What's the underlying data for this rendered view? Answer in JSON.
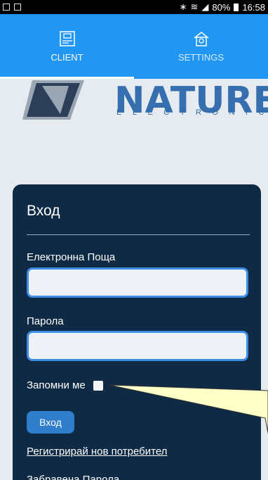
{
  "status_bar": {
    "battery": "80%",
    "time": "16:58"
  },
  "tabs": [
    {
      "label": "CLIENT",
      "icon": "device-icon",
      "active": true
    },
    {
      "label": "SETTINGS",
      "icon": "home-settings-icon",
      "active": false
    }
  ],
  "logo": {
    "brand": "NATURELA",
    "sub": "ELECTRONICS"
  },
  "login": {
    "title": "Вход",
    "email_label": "Електронна Поща",
    "email_value": "",
    "password_label": "Парола",
    "password_value": "",
    "remember_label": "Запомни ме",
    "remember_checked": false,
    "submit_label": "Вход",
    "register_link": "Регистрирай нов потребител",
    "forgot_link": "Забравена Парола"
  },
  "colors": {
    "tab_bar": "#2196f3",
    "card": "#0e2a44",
    "input_border": "#3e8ee6",
    "button": "#2f7ecb",
    "callout": "#ffffc8"
  }
}
